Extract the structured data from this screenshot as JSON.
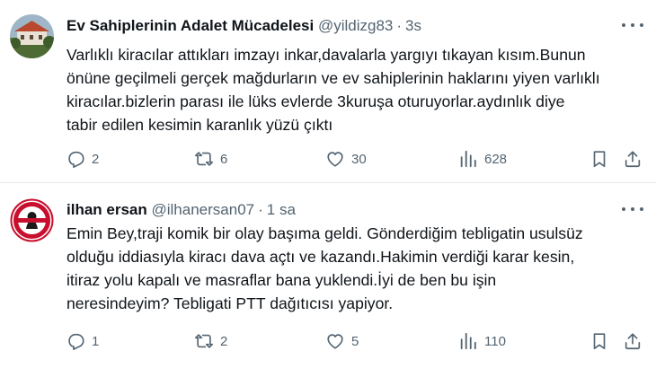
{
  "tweets": [
    {
      "name": "Ev Sahiplerinin Adalet Mücadelesi",
      "handle": "@yildizg83",
      "time": "3s",
      "lines": [
        "Varlıklı kiracılar attıkları imzayı inkar,davalarla yargıyı tıkayan kısım.Bunun",
        "önüne geçilmeli gerçek mağdurların ve ev sahiplerinin haklarını yiyen varlıklı",
        "kiracılar.bizlerin parası ile lüks evlerde 3kuruşa oturuyorlar.aydınlık diye",
        "tabir edilen kesimin karanlık yüzü çıktı"
      ],
      "replies": "2",
      "reposts": "6",
      "likes": "30",
      "views": "628"
    },
    {
      "name": "ilhan ersan",
      "handle": "@ilhanersan07",
      "time": "1 sa",
      "lines": [
        "Emin Bey,traji komik bir olay başıma geldi. Gönderdiğim tebligatin usulsüz",
        "olduğu iddiasıyla kiracı dava açtı ve kazandı.Hakimin verdiği karar kesin,",
        "itiraz yolu kapalı ve masraflar bana yuklendi.İyi de ben bu işin",
        "neresindeyim? Tebligati PTT dağıtıcısı yapiyor."
      ],
      "replies": "1",
      "reposts": "2",
      "likes": "5",
      "views": "110"
    }
  ],
  "colors": {
    "text": "#0f1419",
    "muted": "#536471",
    "divider": "#e4e8ea",
    "seal_red": "#c8102e"
  },
  "icons": [
    "reply-icon",
    "repost-icon",
    "like-icon",
    "views-icon",
    "bookmark-icon",
    "share-icon",
    "more-icon"
  ]
}
